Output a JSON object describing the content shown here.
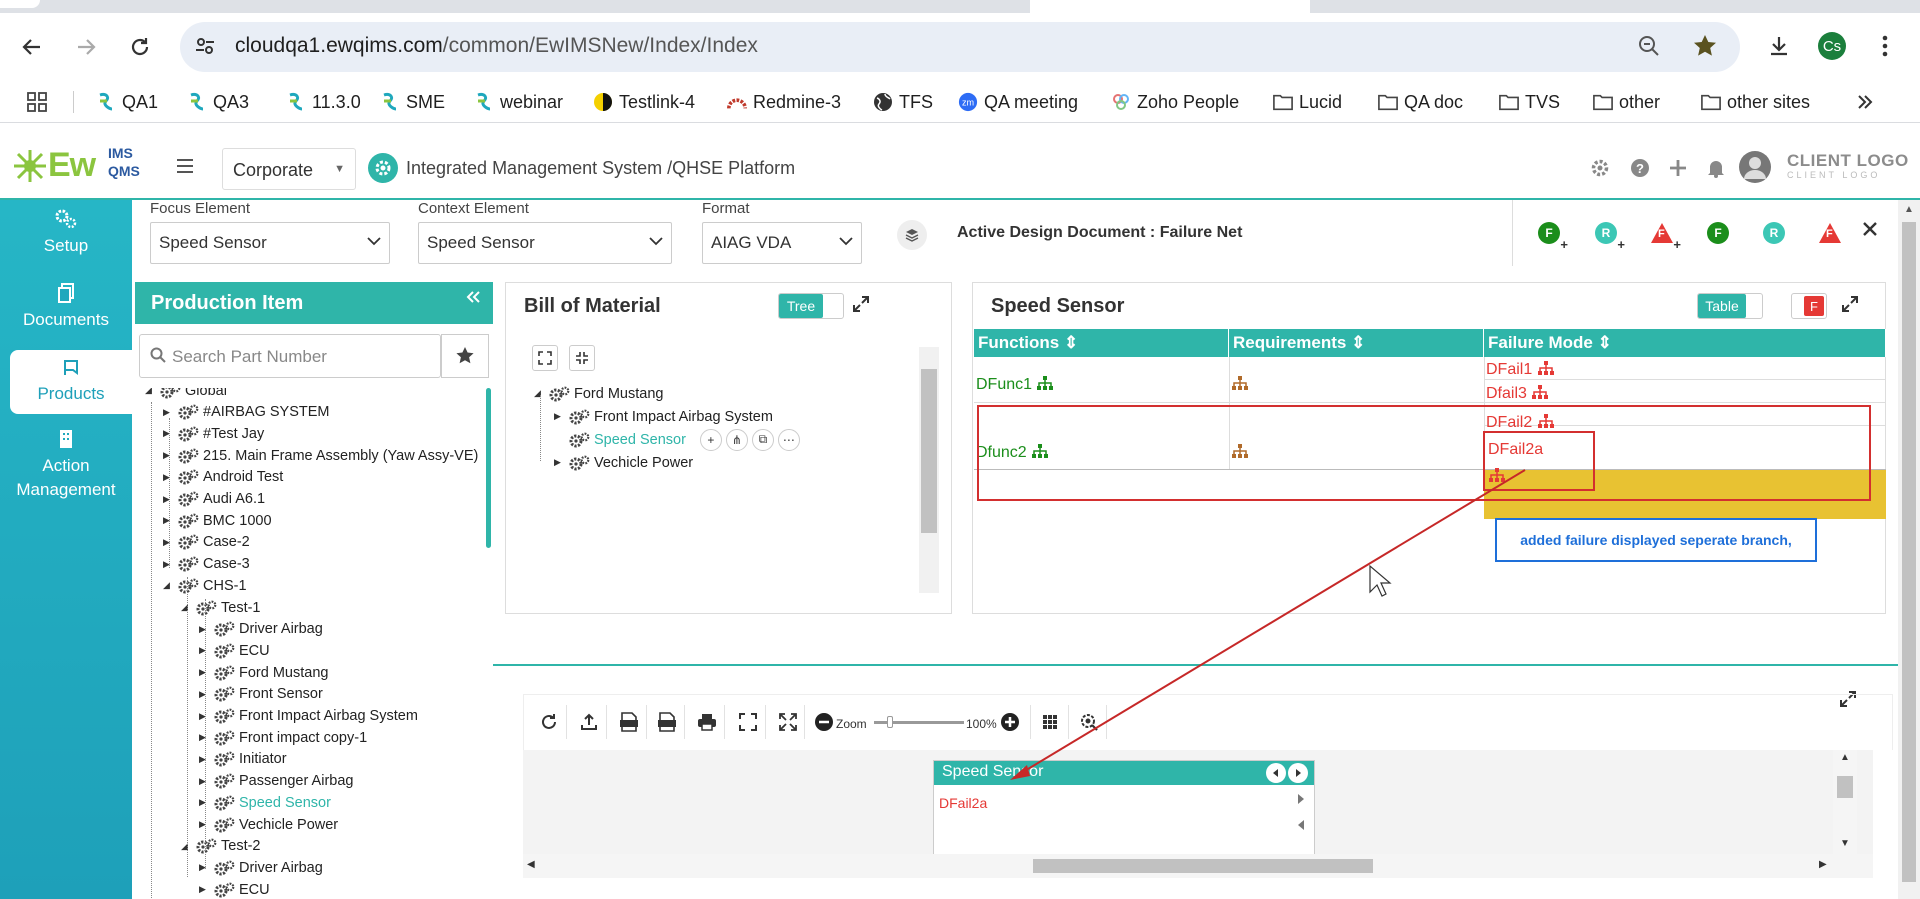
{
  "browser": {
    "url_host": "cloudqa1.ewqims.com",
    "url_path": "/common/EwIMSNew/Index/Index",
    "profile_initials": "Cs"
  },
  "bookmarks": [
    {
      "label": "QA1",
      "icon": "ewqims-icon"
    },
    {
      "label": "QA3",
      "icon": "ewqims-icon"
    },
    {
      "label": "11.3.0",
      "icon": "ewqims-icon"
    },
    {
      "label": "SME",
      "icon": "ewqims-icon"
    },
    {
      "label": "webinar",
      "icon": "ewqims-icon"
    },
    {
      "label": "Testlink-4",
      "icon": "testlink-icon"
    },
    {
      "label": "Redmine-3",
      "icon": "redmine-icon"
    },
    {
      "label": "TFS",
      "icon": "globe-icon"
    },
    {
      "label": "QA meeting",
      "icon": "zoom-icon"
    },
    {
      "label": "Zoho People",
      "icon": "zoho-icon"
    },
    {
      "label": "Lucid",
      "icon": "folder-icon"
    },
    {
      "label": "QA doc",
      "icon": "folder-icon"
    },
    {
      "label": "TVS",
      "icon": "folder-icon"
    },
    {
      "label": "other",
      "icon": "folder-icon"
    },
    {
      "label": "other sites",
      "icon": "folder-icon"
    }
  ],
  "app": {
    "logo_main": "Ew",
    "logo_ims": "IMS",
    "logo_qms": "QMS",
    "org_select": "Corporate",
    "platform_title": "Integrated Management System /QHSE Platform",
    "client_logo": "CLIENT LOGO",
    "client_logo_sub": "CLIENT LOGO"
  },
  "leftnav": [
    {
      "label": "Setup"
    },
    {
      "label": "Documents"
    },
    {
      "label": "Products"
    },
    {
      "label": "Action Management"
    }
  ],
  "filters": {
    "focus_label": "Focus Element",
    "focus_value": "Speed Sensor",
    "context_label": "Context Element",
    "context_value": "Speed Sensor",
    "format_label": "Format",
    "format_value": "AIAG VDA",
    "active_doc": "Active Design Document : Failure Net",
    "tool_letters": [
      "F",
      "R",
      "F",
      "F",
      "R",
      "F"
    ]
  },
  "production": {
    "title": "Production Item",
    "search_placeholder": "Search Part Number",
    "tree": [
      {
        "label": "Global",
        "level": 0,
        "exp": "◢"
      },
      {
        "label": "#AIRBAG SYSTEM",
        "level": 1,
        "exp": "▶"
      },
      {
        "label": "#Test Jay",
        "level": 1,
        "exp": "▶"
      },
      {
        "label": "215. Main Frame Assembly (Yaw Assy-VE)",
        "level": 1,
        "exp": "▶"
      },
      {
        "label": "Android Test",
        "level": 1,
        "exp": "▶"
      },
      {
        "label": "Audi A6.1",
        "level": 1,
        "exp": "▶"
      },
      {
        "label": "BMC 1000",
        "level": 1,
        "exp": "▶"
      },
      {
        "label": "Case-2",
        "level": 1,
        "exp": "▶"
      },
      {
        "label": "Case-3",
        "level": 1,
        "exp": "▶"
      },
      {
        "label": "CHS-1",
        "level": 1,
        "exp": "◢"
      },
      {
        "label": "Test-1",
        "level": 2,
        "exp": "◢"
      },
      {
        "label": "Driver Airbag",
        "level": 3,
        "exp": "▶"
      },
      {
        "label": "ECU",
        "level": 3,
        "exp": "▶"
      },
      {
        "label": "Ford Mustang",
        "level": 3,
        "exp": "▶"
      },
      {
        "label": "Front Sensor",
        "level": 3,
        "exp": "▶"
      },
      {
        "label": "Front Impact Airbag System",
        "level": 3,
        "exp": "▶"
      },
      {
        "label": "Front impact copy-1",
        "level": 3,
        "exp": "▶"
      },
      {
        "label": "Initiator",
        "level": 3,
        "exp": "▶"
      },
      {
        "label": "Passenger Airbag",
        "level": 3,
        "exp": "▶"
      },
      {
        "label": "Speed Sensor",
        "level": 3,
        "exp": "▶",
        "selected": true
      },
      {
        "label": "Vechicle Power",
        "level": 3,
        "exp": "▶"
      },
      {
        "label": "Test-2",
        "level": 2,
        "exp": "◢"
      },
      {
        "label": "Driver Airbag",
        "level": 3,
        "exp": "▶"
      },
      {
        "label": "ECU",
        "level": 3,
        "exp": "▶"
      }
    ]
  },
  "bom": {
    "title": "Bill of Material",
    "toggle_label": "Tree",
    "tree": [
      {
        "label": "Ford Mustang",
        "level": 0,
        "exp": "◢"
      },
      {
        "label": "Front Impact Airbag System",
        "level": 1,
        "exp": "▶"
      },
      {
        "label": "Speed Sensor",
        "level": 1,
        "exp": "",
        "selected": true
      },
      {
        "label": "Vechicle Power",
        "level": 1,
        "exp": "▶"
      }
    ],
    "row_actions": [
      "+",
      "⋔",
      "⧉",
      "⋯"
    ]
  },
  "sensor": {
    "title": "Speed Sensor",
    "toggle_label": "Table",
    "f_toggle": "F",
    "columns": [
      "Functions",
      "Requirements",
      "Failure Mode"
    ],
    "rows": [
      {
        "function": "DFunc1",
        "failures": [
          "DFail1",
          "Dfail3"
        ]
      },
      {
        "function": "Dfunc2",
        "failures": [
          "DFail2",
          "DFail2a"
        ]
      }
    ],
    "callout": "added failure displayed seperate branch,"
  },
  "graph": {
    "zoom_label": "Zoom",
    "zoom_value": "100%",
    "zoom_fraction": 0.15,
    "node_title": "Speed  Sensor",
    "node_item": "DFail2a"
  }
}
